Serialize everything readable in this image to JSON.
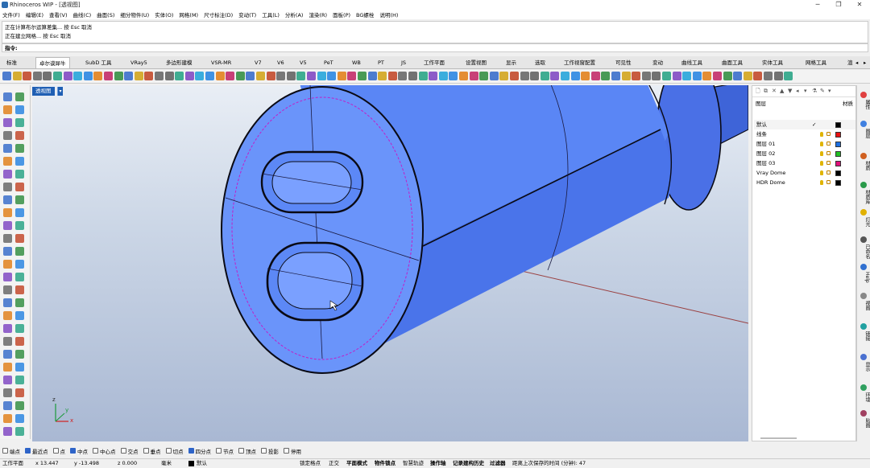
{
  "window": {
    "title": "Rhinoceros WIP - [透视图]"
  },
  "menu": [
    "文件(F)",
    "编辑(E)",
    "查看(V)",
    "曲线(C)",
    "曲面(S)",
    "细分物件(U)",
    "实体(O)",
    "网格(M)",
    "尺寸标注(D)",
    "变动(T)",
    "工具(L)",
    "分析(A)",
    "渲染(R)",
    "面板(P)",
    "BG螺栓",
    "说明(H)"
  ],
  "command": {
    "history": [
      "正在计算布尔运算差集... 按 Esc 取消",
      "正在建立网格... 按 Esc 取消"
    ],
    "prompt": "指令:"
  },
  "tabs": [
    "标准",
    "卓尔谟犀牛",
    "SubD 工具",
    "VRay5",
    "多边形建模",
    "VSR-MR",
    "V7",
    "V6",
    "V5",
    "PeT",
    "WB",
    "PT",
    "JS",
    "工作平面",
    "设置视图",
    "显示",
    "选取",
    "工作视窗配置",
    "可见性",
    "变动",
    "曲线工具",
    "曲面工具",
    "实体工具",
    "网格工具",
    "渲"
  ],
  "active_tab": "卓尔谟犀牛",
  "viewport": {
    "label": "透视图",
    "axes": {
      "x": "x",
      "y": "y",
      "z": "z"
    }
  },
  "layers": {
    "title": "图层",
    "col_material": "材质",
    "rows": [
      {
        "name": "默认",
        "current": true,
        "color": "#000000"
      },
      {
        "name": "线条",
        "color": "#e81010"
      },
      {
        "name": "图层 01",
        "color": "#1e6fe0"
      },
      {
        "name": "图层 02",
        "color": "#22c022"
      },
      {
        "name": "图层 03",
        "color": "#e0107a"
      },
      {
        "name": "Vray Dome",
        "color": "#000000"
      },
      {
        "name": "HDR Dome",
        "color": "#000000"
      }
    ]
  },
  "right_tabs": [
    "属性",
    "图层",
    "材质",
    "材质库",
    "灯光",
    "已命名",
    "Help",
    "视图",
    "链接",
    "显示",
    "环境",
    "贴图"
  ],
  "osnaps": [
    {
      "label": "端点",
      "on": false
    },
    {
      "label": "最近点",
      "on": true
    },
    {
      "label": "点",
      "on": false
    },
    {
      "label": "中点",
      "on": true
    },
    {
      "label": "中心点",
      "on": false
    },
    {
      "label": "交点",
      "on": false
    },
    {
      "label": "垂点",
      "on": false
    },
    {
      "label": "切点",
      "on": false
    },
    {
      "label": "四分点",
      "on": true
    },
    {
      "label": "节点",
      "on": false
    },
    {
      "label": "顶点",
      "on": false
    },
    {
      "label": "投影",
      "on": false
    },
    {
      "label": "停用",
      "on": false
    }
  ],
  "status": {
    "cplane": "工作平面",
    "x": "x 13.447",
    "y": "y -13.498",
    "z": "z 0.000",
    "units": "毫米",
    "layer": "默认",
    "toggles": [
      "锁定格点",
      "正交",
      "平面模式",
      "物件锁点",
      "智慧轨迹",
      "操作轴",
      "记录建构历史",
      "过滤器"
    ],
    "message": "距离上次保存的时间 (分钟): 47"
  },
  "colors": {
    "accent": "#1f5fb4",
    "model_fill": "#4d7bf2",
    "model_edge": "#0a0a14",
    "seam": "#c020c8"
  }
}
